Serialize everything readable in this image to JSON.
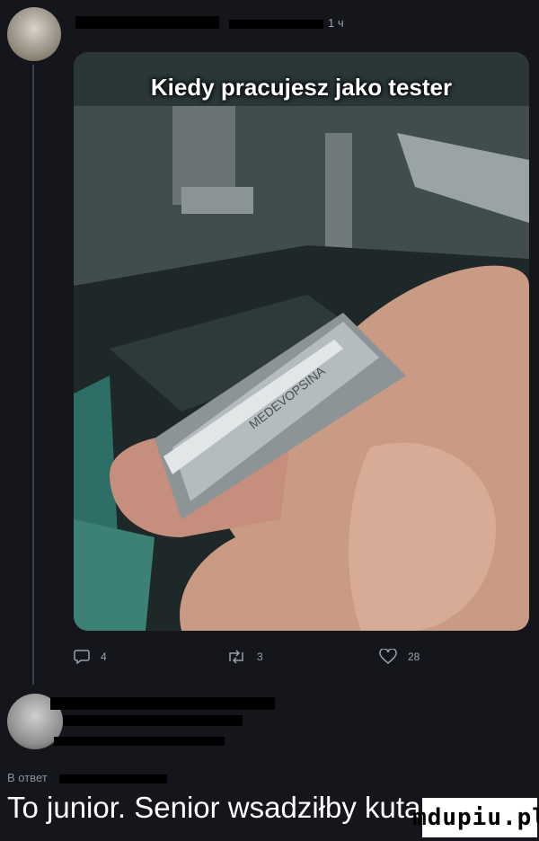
{
  "post": {
    "time": "1 ч",
    "image_caption": "Kiedy pracujesz jako tester",
    "engraving_text": "MEDEVOPSINA",
    "actions": {
      "reply_icon": "speech-bubble-icon",
      "reply_count": "4",
      "retweet_icon": "retweet-icon",
      "retweet_count": "3",
      "like_icon": "heart-icon",
      "like_count": "28"
    }
  },
  "reply": {
    "label": "В ответ",
    "text": "To junior. Senior wsadziłby kutasa."
  },
  "watermark": "mdupiu.pl",
  "colors": {
    "background": "#14161c",
    "icon": "#9aa0aa",
    "text": "#ffffff"
  }
}
